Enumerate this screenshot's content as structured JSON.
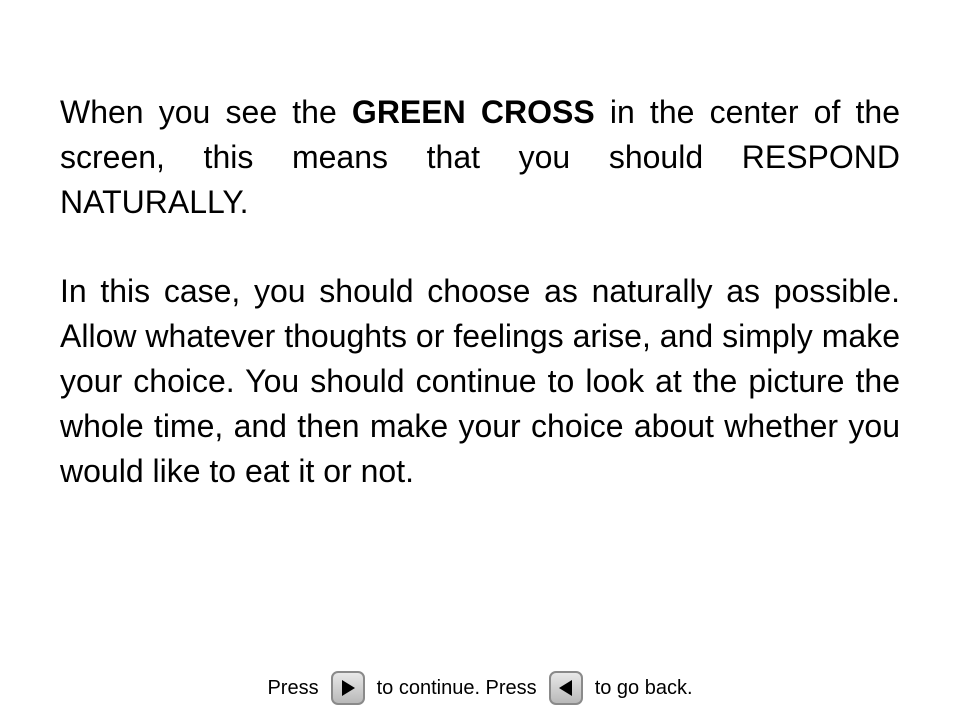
{
  "instructions": {
    "p1_before": "When you see the ",
    "p1_bold": "GREEN CROSS",
    "p1_after": " in the center of the screen, this means that you should RESPOND NATURALLY.",
    "p2": "In this case, you should choose as naturally as possible. Allow whatever thoughts or feelings arise, and simply make your choice. You should continue to look at the picture the whole time, and then make your choice about whether you would like to eat it or not."
  },
  "footer": {
    "press_1": "Press",
    "continue_text": "to continue. Press",
    "back_text": "to go back."
  },
  "icons": {
    "next": "play-right-icon",
    "back": "play-left-icon"
  }
}
